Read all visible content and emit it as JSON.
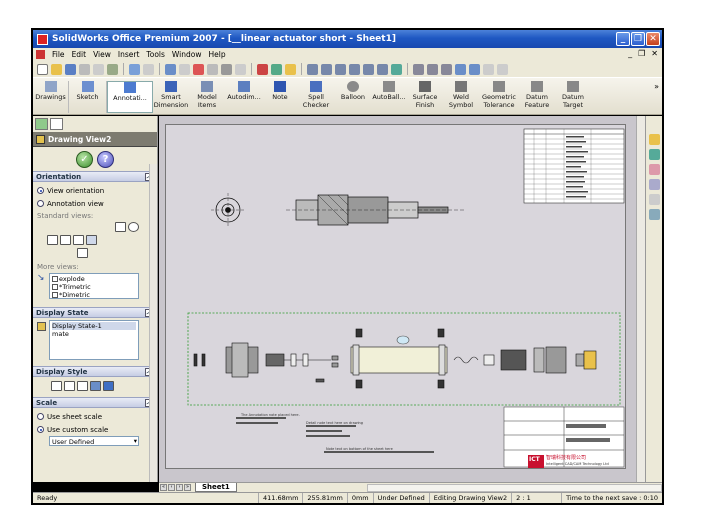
{
  "window": {
    "title": "SolidWorks Office Premium 2007 - [__linear actuator short - Sheet1]"
  },
  "menu": {
    "items": [
      "File",
      "Edit",
      "View",
      "Insert",
      "Tools",
      "Window",
      "Help"
    ]
  },
  "command_manager": {
    "left": [
      {
        "label": "Drawings",
        "icon": "drawings-icon"
      },
      {
        "label": "Sketch",
        "icon": "sketch-icon"
      },
      {
        "label": "Annotati...",
        "icon": "annotation-icon"
      }
    ],
    "tools": [
      {
        "label": "Smart Dimension",
        "icon": "smart-dimension-icon"
      },
      {
        "label": "Model Items",
        "icon": "model-items-icon"
      },
      {
        "label": "Autodim...",
        "icon": "autodimension-icon"
      },
      {
        "label": "Note",
        "icon": "note-icon"
      },
      {
        "label": "Spell Checker",
        "icon": "spell-checker-icon"
      },
      {
        "label": "Balloon",
        "icon": "balloon-icon"
      },
      {
        "label": "AutoBall...",
        "icon": "autoballoon-icon"
      },
      {
        "label": "Surface Finish",
        "icon": "surface-finish-icon"
      },
      {
        "label": "Weld Symbol",
        "icon": "weld-symbol-icon"
      },
      {
        "label": "Geometric Tolerance",
        "icon": "geometric-tolerance-icon"
      },
      {
        "label": "Datum Feature",
        "icon": "datum-feature-icon"
      },
      {
        "label": "Datum Target",
        "icon": "datum-target-icon"
      }
    ]
  },
  "property_manager": {
    "title": "Drawing View2",
    "orientation": {
      "header": "Orientation",
      "view_orientation": "View orientation",
      "annotation_view": "Annotation view",
      "standard_views": "Standard views:",
      "more_views": "More views:",
      "more_list": [
        "explode",
        "*Trimetric",
        "*Dimetric"
      ]
    },
    "display_state": {
      "header": "Display State",
      "items": [
        "Display State-1",
        "mate"
      ]
    },
    "display_style": {
      "header": "Display Style"
    },
    "scale": {
      "header": "Scale",
      "use_sheet": "Use sheet scale",
      "use_custom": "Use custom scale",
      "custom_value": "User Defined"
    }
  },
  "sheet": {
    "tab": "Sheet1",
    "notes": [
      "The Annotation note placed here.",
      "Detail note text here on drawing",
      "Note text on bottom of the sheet here"
    ],
    "company_cn": "智瑞科技有限公司",
    "company_en": "Intelligent CAD/CAM Technology Ltd",
    "logo_text": "ICT"
  },
  "status": {
    "ready": "Ready",
    "x": "411.68mm",
    "y": "255.81mm",
    "z": "0mm",
    "defined": "Under Defined",
    "mode": "Editing Drawing View2",
    "scale": "2 : 1",
    "save": "Time to the next save : 0:10"
  },
  "colors": {
    "accent": "#1f58c2",
    "paper": "#d9d6dc",
    "canvas": "#c9c6cc"
  }
}
